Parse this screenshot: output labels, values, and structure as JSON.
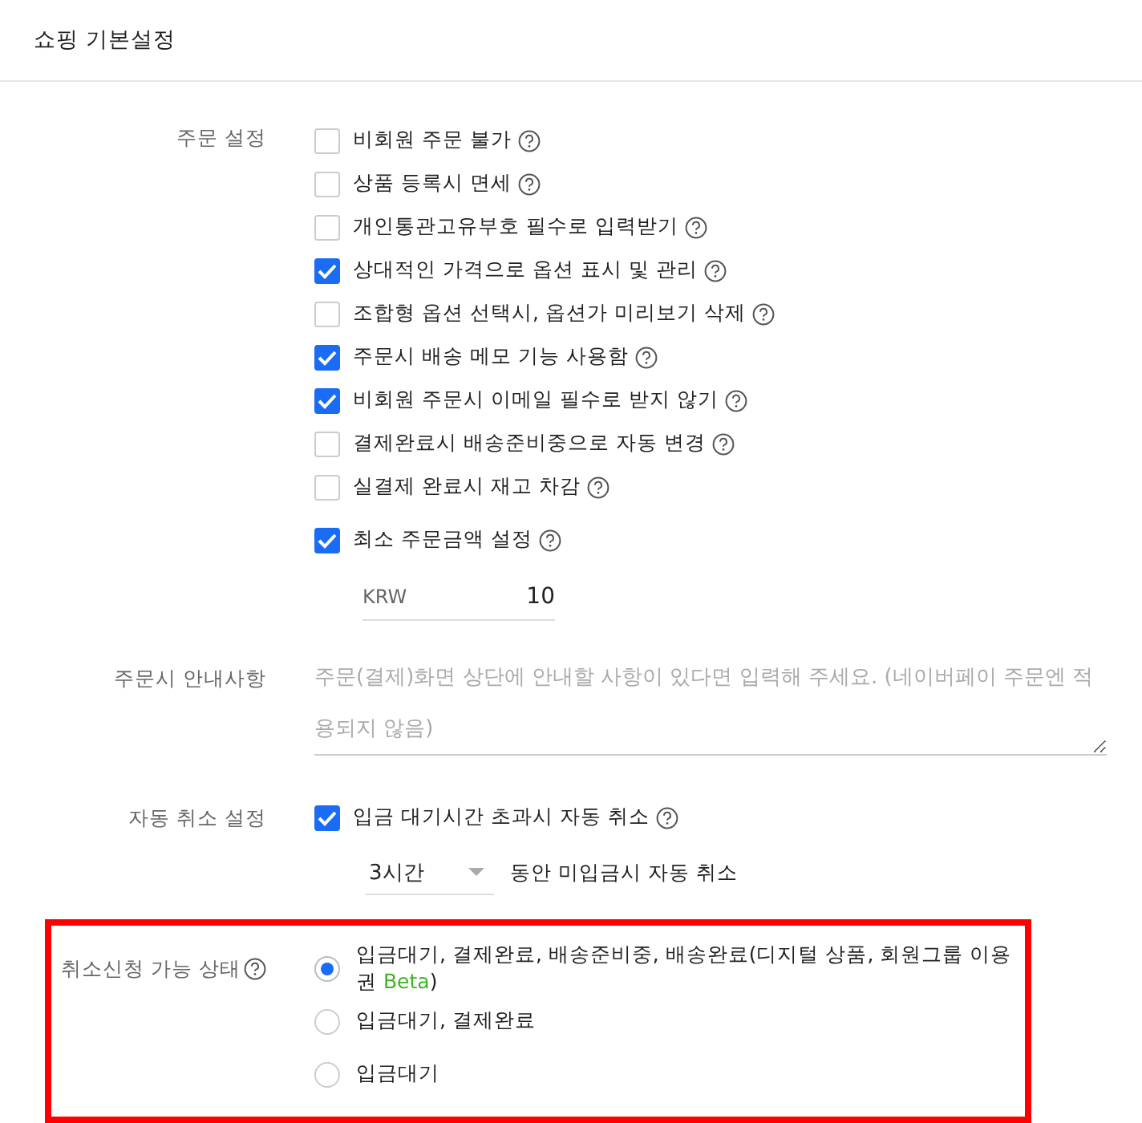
{
  "header": {
    "title": "쇼핑 기본설정"
  },
  "order_settings": {
    "label": "주문 설정",
    "options": [
      {
        "label": "비회원 주문 불가",
        "checked": false
      },
      {
        "label": "상품 등록시 면세",
        "checked": false
      },
      {
        "label": "개인통관고유부호 필수로 입력받기",
        "checked": false
      },
      {
        "label": "상대적인 가격으로 옵션 표시 및 관리",
        "checked": true
      },
      {
        "label": "조합형 옵션 선택시, 옵션가 미리보기 삭제",
        "checked": false
      },
      {
        "label": "주문시 배송 메모 기능 사용함",
        "checked": true
      },
      {
        "label": "비회원 주문시 이메일 필수로 받지 않기",
        "checked": true
      },
      {
        "label": "결제완료시 배송준비중으로 자동 변경",
        "checked": false
      },
      {
        "label": "실결제 완료시 재고 차감",
        "checked": false
      }
    ],
    "min_order": {
      "label": "최소 주문금액 설정",
      "checked": true,
      "currency": "KRW",
      "value": "10"
    }
  },
  "order_notice": {
    "label": "주문시 안내사항",
    "placeholder": "주문(결제)화면 상단에 안내할 사항이 있다면 입력해 주세요. (네이버페이 주문엔 적용되지 않음)"
  },
  "auto_cancel": {
    "label": "자동 취소 설정",
    "option": {
      "label": "입금 대기시간 초과시 자동 취소",
      "checked": true
    },
    "duration": "3시간",
    "suffix": "동안 미입금시 자동 취소"
  },
  "cancel_request": {
    "label": "취소신청 가능 상태",
    "highlighted": true,
    "options": [
      {
        "label": "입금대기, 결제완료, 배송준비중, 배송완료(디지털 상품, 회원그룹 이용권",
        "tag": "Beta",
        "tail": ")",
        "selected": true
      },
      {
        "label": "입금대기, 결제완료",
        "selected": false
      },
      {
        "label": "입금대기",
        "selected": false
      }
    ]
  }
}
